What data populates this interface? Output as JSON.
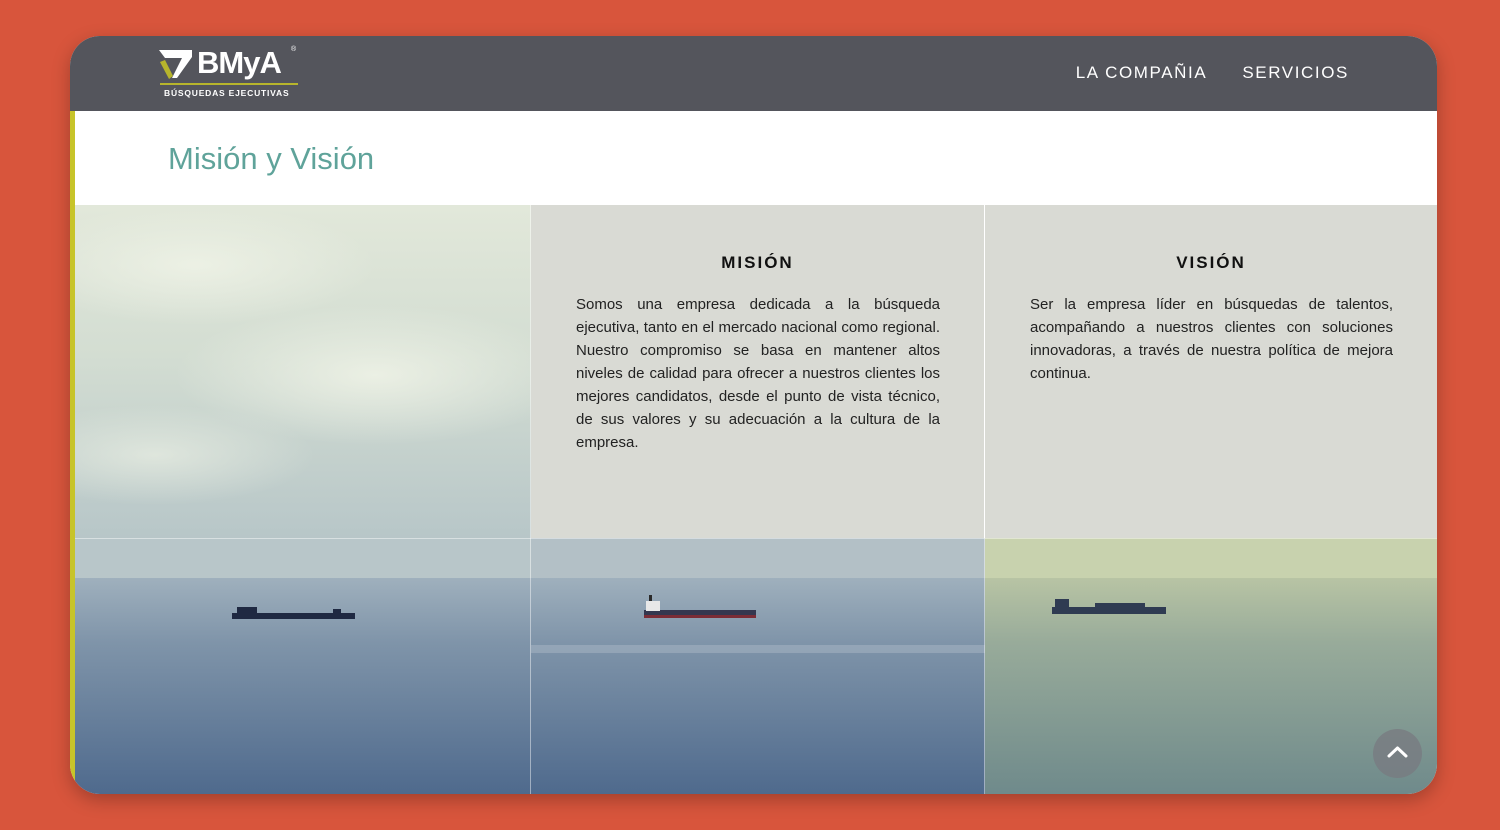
{
  "brand": {
    "logo_text": "BMyA",
    "registered_mark": "®",
    "tagline": "BÚSQUEDAS EJECUTIVAS",
    "accent_color": "#b7b52c"
  },
  "nav": {
    "items": [
      {
        "label": "LA COMPAÑIA"
      },
      {
        "label": "SERVICIOS"
      }
    ]
  },
  "page": {
    "title": "Misión y Visión"
  },
  "sections": {
    "mision": {
      "heading": "MISIÓN",
      "body": "Somos una empresa dedicada a la búsqueda ejecutiva, tanto en el mercado nacional como regional. Nuestro compromiso se basa en mantener altos niveles de calidad para ofrecer a nuestros clientes los mejores candidatos, desde el punto de vista técnico, de sus valores y su adecuación a la cultura de la empresa."
    },
    "vision": {
      "heading": "VISIÓN",
      "body": "Ser la empresa líder en búsquedas de talentos, acompañando a nuestros clientes con soluciones innovadoras, a través de nuestra política de mejora continua."
    }
  },
  "icons": {
    "scroll_top": "chevron-up-icon",
    "logo_mark": "logo-mark-icon"
  },
  "colors": {
    "page_background": "#d8553c",
    "navbar": "#54555c",
    "title_color": "#5fa39a",
    "panel": "#d9dad4",
    "side_accent": "#c7c42a"
  }
}
